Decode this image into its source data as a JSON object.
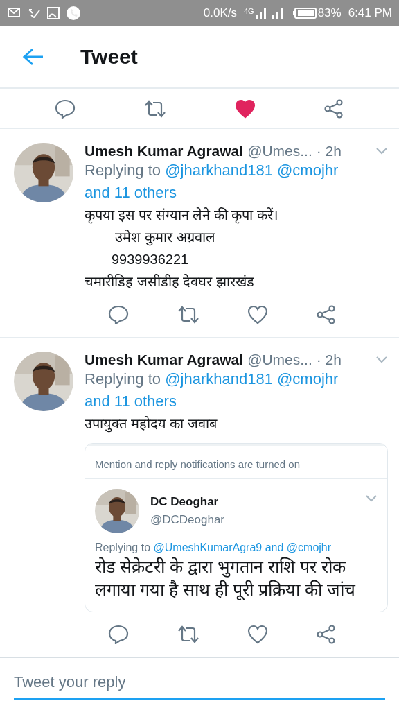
{
  "status_bar": {
    "speed": "0.0K/s",
    "network": "4G",
    "battery": "83%",
    "time": "6:41 PM"
  },
  "header": {
    "title": "Tweet"
  },
  "main_actions": {
    "liked": true
  },
  "tweets": [
    {
      "name": "Umesh Kumar Agrawal",
      "handle": "@Umes...",
      "time": "· 2h",
      "replying": {
        "prefix": "Replying to",
        "mentions": [
          "@jharkhand181",
          "@cmojhr",
          "and 11 others"
        ]
      },
      "lines": [
        "कृपया इस पर संग्यान लेने की कृपा करें।",
        "        उमेश कुमार अग्रवाल",
        "       9939936221",
        "चमारीडिह जसीडीह देवघर झारखंड"
      ],
      "liked": false
    },
    {
      "name": "Umesh Kumar Agrawal",
      "handle": "@Umes...",
      "time": "· 2h",
      "replying": {
        "prefix": "Replying to",
        "mentions": [
          "@jharkhand181",
          "@cmojhr",
          "and 11 others"
        ]
      },
      "lines": [
        "उपायुक्त महोदय का जवाब"
      ],
      "liked": false,
      "quote": {
        "notice": "Mention and reply notifications are turned on",
        "name": "DC Deoghar",
        "handle": "@DCDeoghar",
        "replying": {
          "prefix": "Replying to",
          "mentions": [
            "@UmeshKumarAgra9 and @cmojhr"
          ]
        },
        "body": "रोड सेक्रेटरी के द्वारा भुगतान राशि पर रोक लगाया गया है साथ ही पूरी प्रक्रिया की जांच"
      }
    }
  ],
  "reply_bar": {
    "placeholder": "Tweet your reply"
  }
}
